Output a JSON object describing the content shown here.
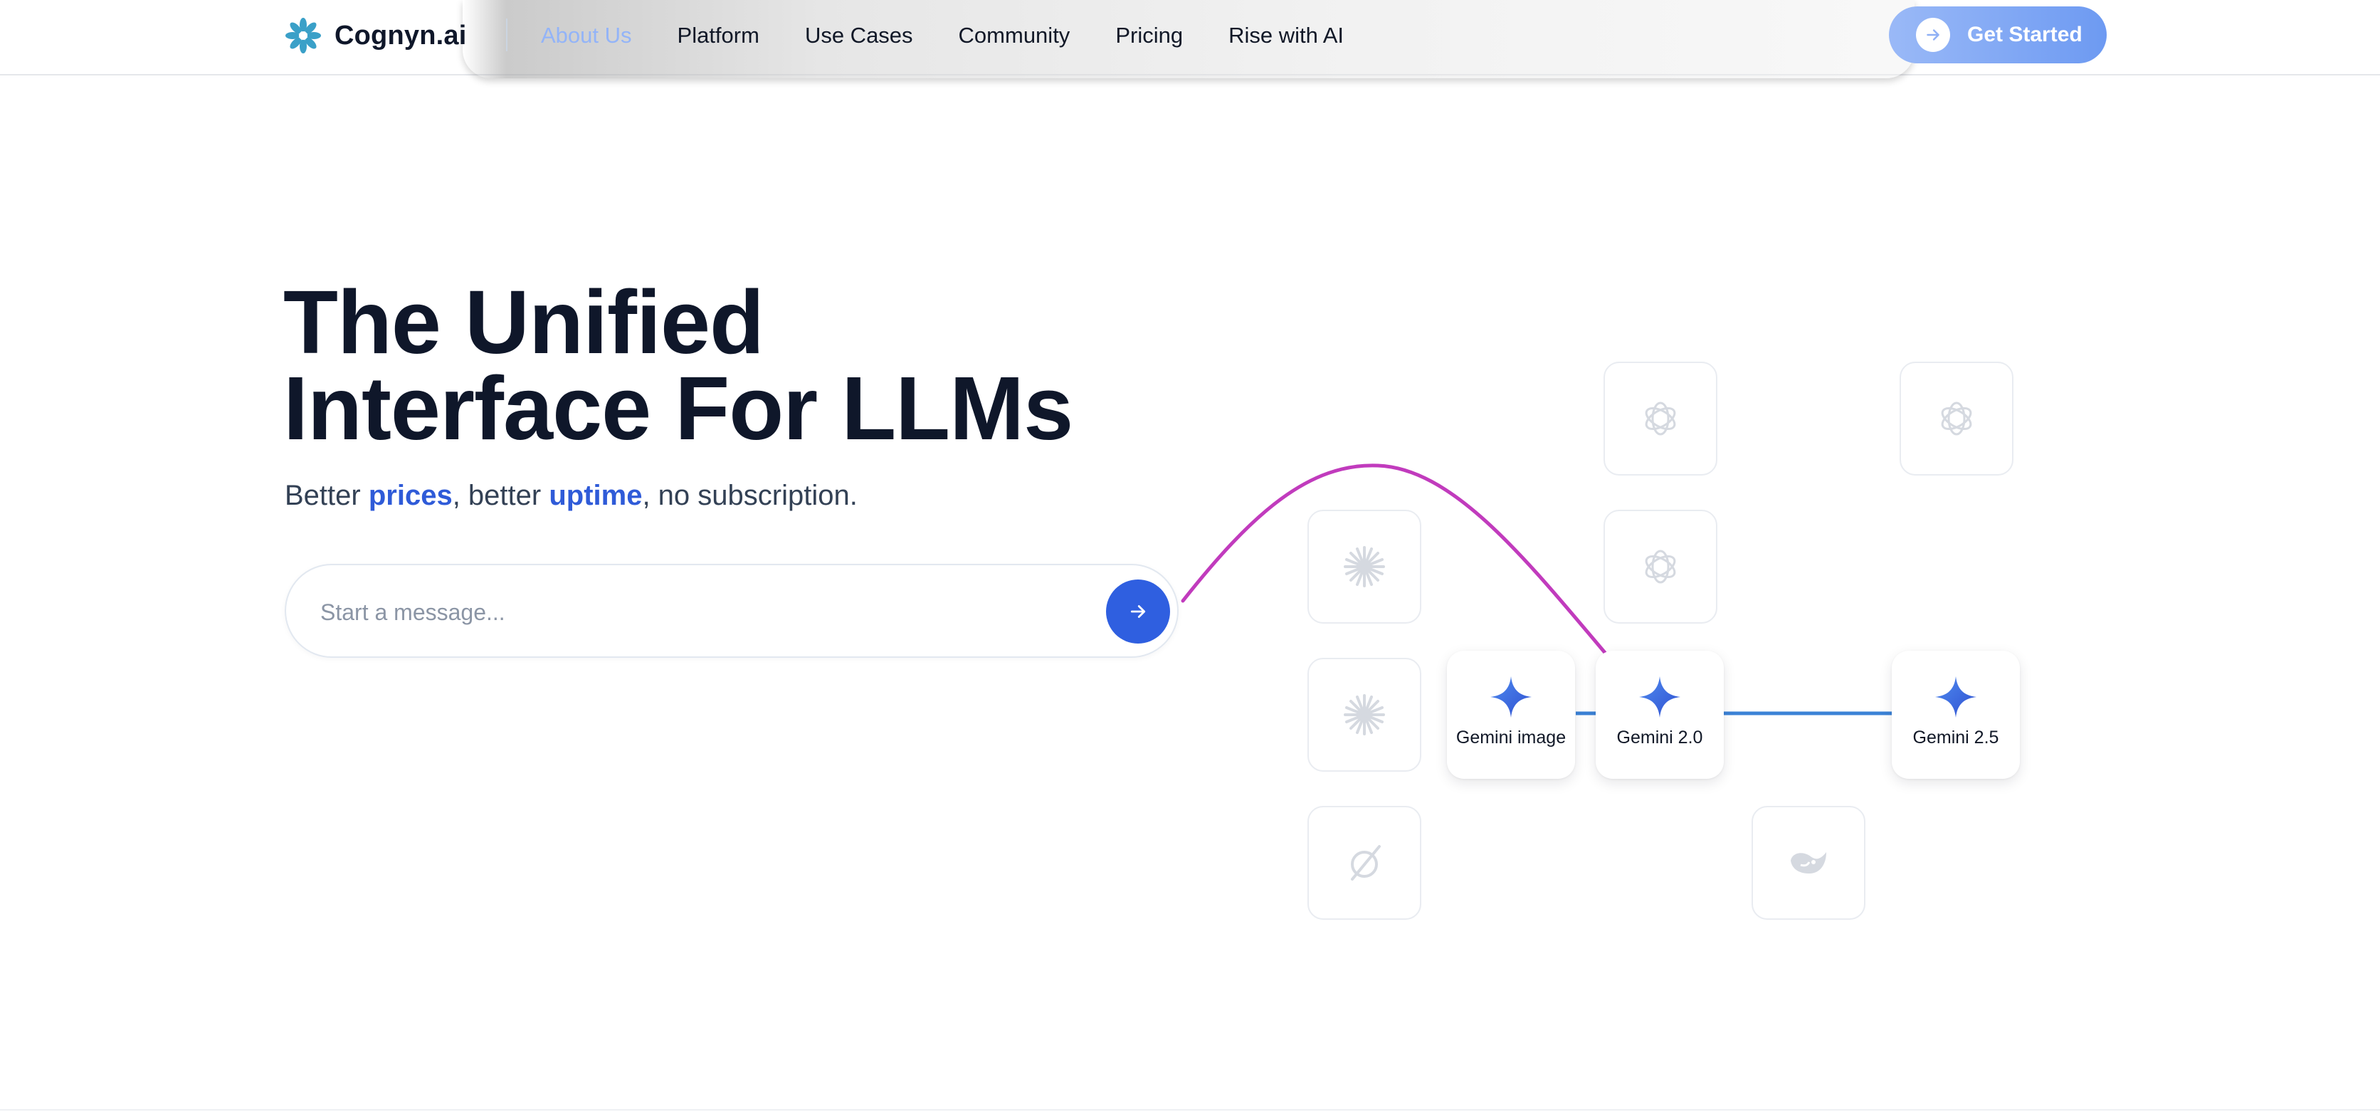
{
  "brand": {
    "name": "Cognyn.ai",
    "logo_icon": "asterisk-logo-icon",
    "logo_color": "#3aa0c8"
  },
  "nav": {
    "links": [
      {
        "label": "About Us",
        "active": true
      },
      {
        "label": "Platform",
        "active": false
      },
      {
        "label": "Use Cases",
        "active": false
      },
      {
        "label": "Community",
        "active": false
      },
      {
        "label": "Pricing",
        "active": false
      },
      {
        "label": "Rise with AI",
        "active": false
      }
    ],
    "cta_label": "Get Started",
    "cta_icon": "arrow-right-icon"
  },
  "hero": {
    "title_line1": "The Unified",
    "title_line2": "Interface For LLMs",
    "subtitle_part1": "Better ",
    "subtitle_hl1": "prices",
    "subtitle_part2": ", better ",
    "subtitle_hl2": "uptime",
    "subtitle_part3": ", no subscription.",
    "input_placeholder": "Start a message...",
    "input_value": "",
    "send_icon": "arrow-right-icon"
  },
  "models": {
    "featured": [
      {
        "label": "Gemini image",
        "icon": "gemini-sparkle-icon"
      },
      {
        "label": "Gemini 2.0",
        "icon": "gemini-sparkle-icon"
      },
      {
        "label": "Gemini 2.5",
        "icon": "gemini-sparkle-icon"
      }
    ],
    "background_tiles": [
      {
        "icon": "openai-icon"
      },
      {
        "icon": "openai-icon"
      },
      {
        "icon": "openai-icon"
      },
      {
        "icon": "anthropic-icon"
      },
      {
        "icon": "anthropic-icon"
      },
      {
        "icon": "grok-icon"
      },
      {
        "icon": "deepseek-icon"
      }
    ]
  },
  "colors": {
    "accent": "#2f5bd8",
    "title": "#0f172a",
    "route_curve": "#c13bbd",
    "route_line": "#3b82d6",
    "cta_start": "#9ab9f7",
    "cta_end": "#6d9af2"
  }
}
